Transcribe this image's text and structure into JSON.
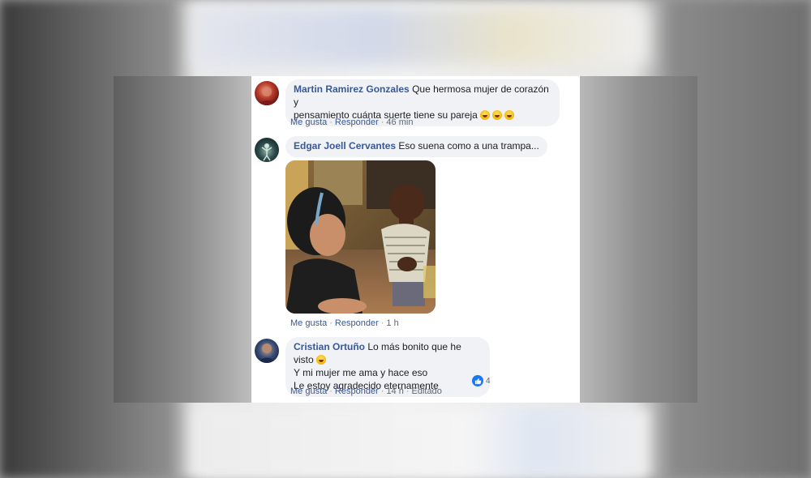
{
  "comments": [
    {
      "author": "Martin Ramirez Gonzales",
      "text_line1": "Que hermosa mujer de corazón y",
      "text_line2": "pensamiento cuánta suerte tiene su pareja",
      "emojis": [
        "grinning-emoji",
        "grinning-emoji",
        "grinning-emoji"
      ],
      "like_label": "Me gusta",
      "reply_label": "Responder",
      "time": "46 min"
    },
    {
      "author": "Edgar Joell Cervantes",
      "text": "Eso suena como a una trampa...",
      "like_label": "Me gusta",
      "reply_label": "Responder",
      "time": "1 h"
    },
    {
      "author": "Cristian Ortuño",
      "text_line1": "Lo más bonito que he visto",
      "text_line2": "Y mi mujer me ama y hace eso",
      "text_line3": "Le estoy agradecido eternamente",
      "like_label": "Me gusta",
      "reply_label": "Responder",
      "time": "14 h",
      "edited_label": "Editado",
      "reaction_count": "4"
    }
  ],
  "colors": {
    "link": "#385898",
    "bubble": "#f0f2f5",
    "like": "#1877f2"
  }
}
